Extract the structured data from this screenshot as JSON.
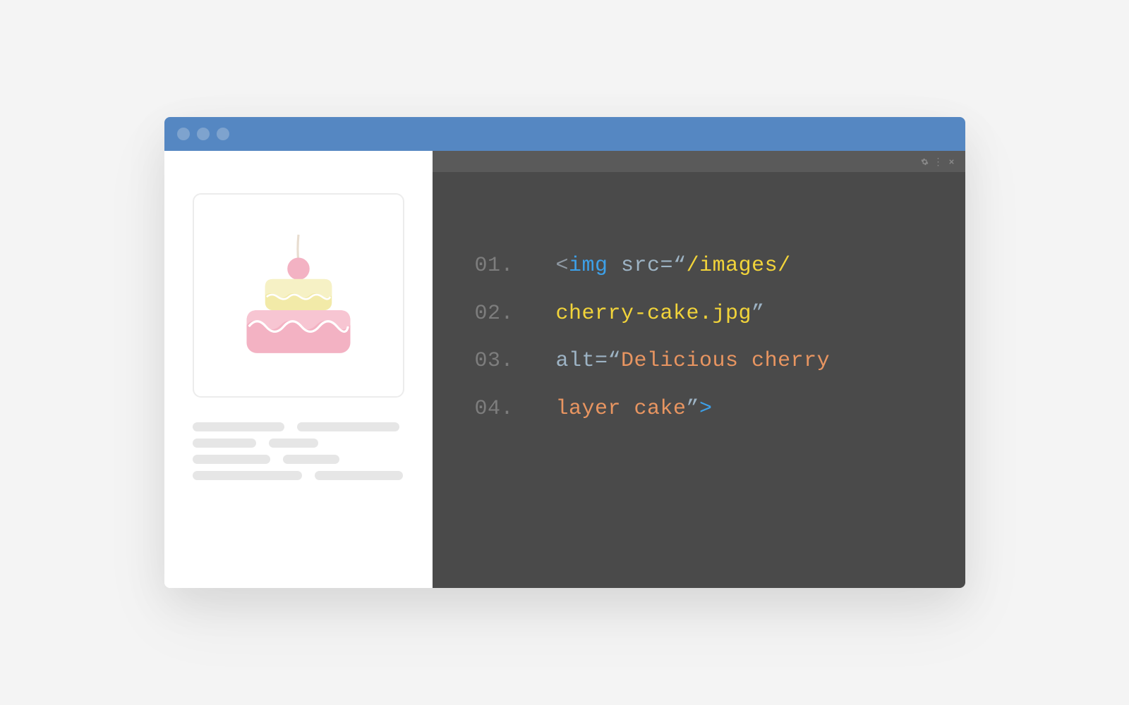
{
  "code": {
    "lines": [
      {
        "num": "01.",
        "tokens": [
          {
            "cls": "tok-bracket",
            "t": "<"
          },
          {
            "cls": "tok-tag",
            "t": "img"
          },
          {
            "cls": "",
            "t": " "
          },
          {
            "cls": "tok-attr",
            "t": "src="
          },
          {
            "cls": "tok-quote",
            "t": "“"
          },
          {
            "cls": "tok-string-yellow",
            "t": "/images/"
          }
        ]
      },
      {
        "num": "02.",
        "tokens": [
          {
            "cls": "tok-string-yellow",
            "t": "cherry-cake.jpg"
          },
          {
            "cls": "tok-quote",
            "t": "”"
          }
        ]
      },
      {
        "num": "03.",
        "tokens": [
          {
            "cls": "tok-attr",
            "t": "alt="
          },
          {
            "cls": "tok-quote",
            "t": "“"
          },
          {
            "cls": "tok-string-orange",
            "t": "Delicious cherry"
          }
        ]
      },
      {
        "num": "04.",
        "tokens": [
          {
            "cls": "tok-string-orange",
            "t": "layer cake"
          },
          {
            "cls": "tok-quote",
            "t": "”"
          },
          {
            "cls": "tok-tag",
            "t": ">"
          }
        ]
      }
    ]
  },
  "image": {
    "subject": "cherry-layer-cake",
    "alt": "Delicious cherry layer cake"
  }
}
